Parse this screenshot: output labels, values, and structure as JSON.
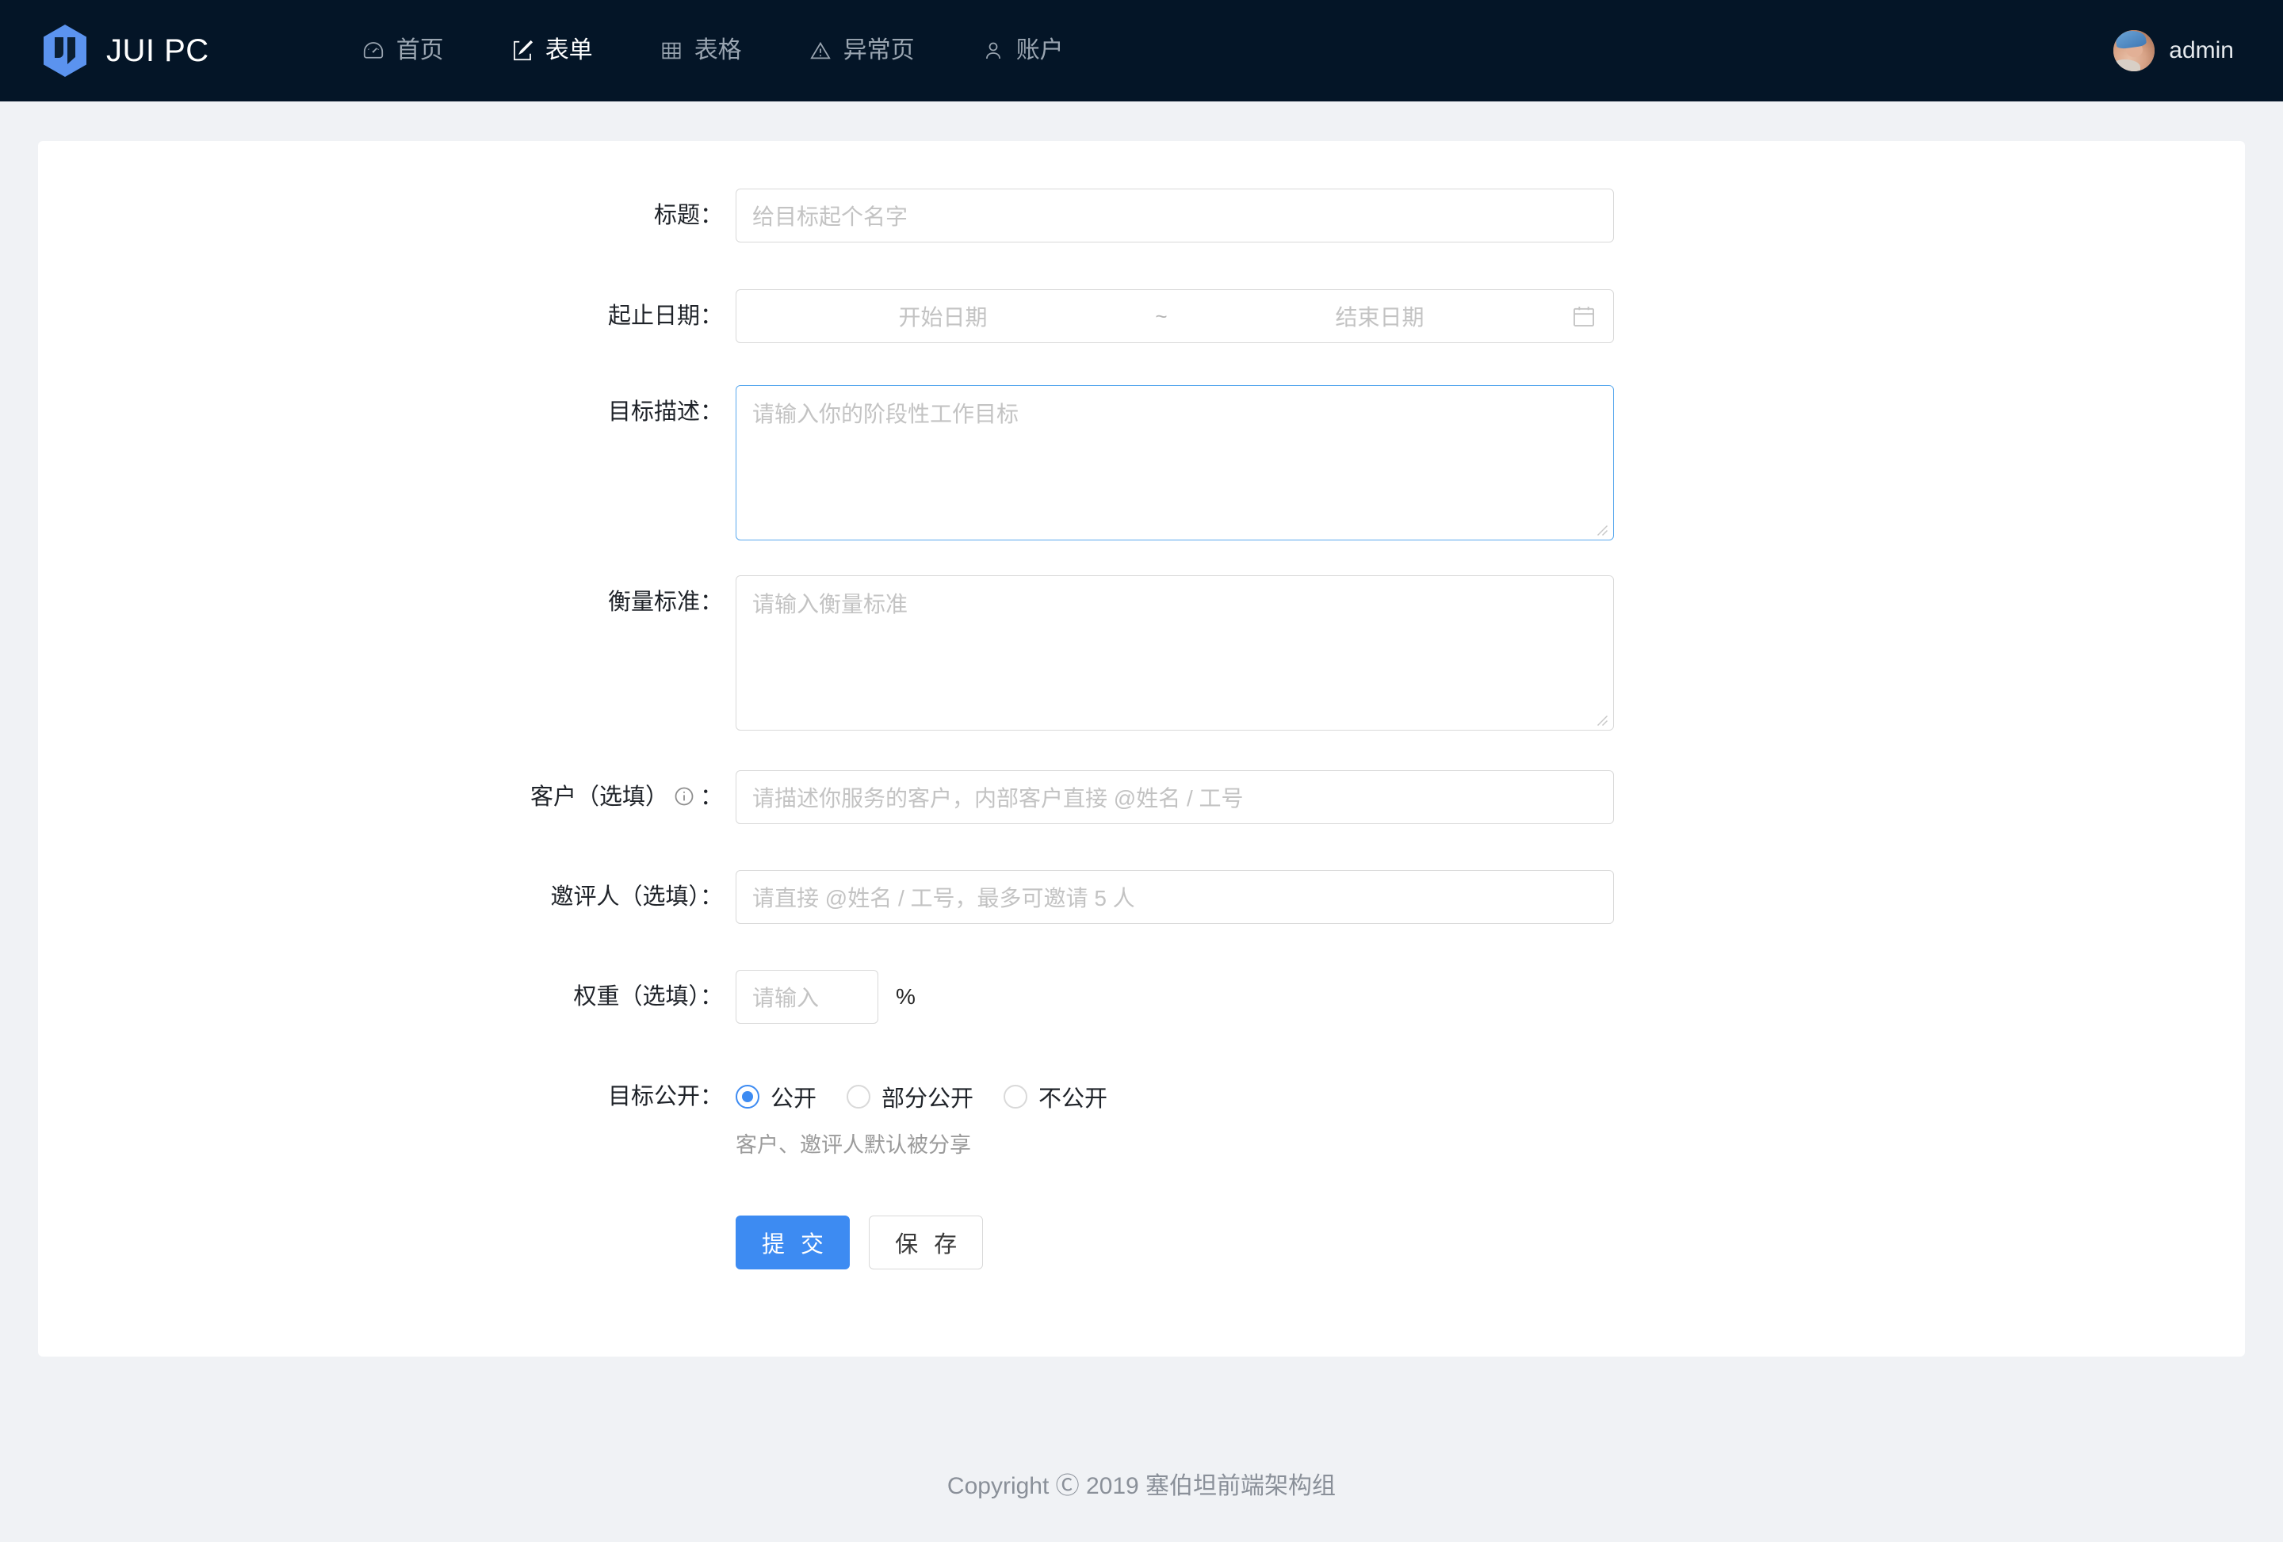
{
  "header": {
    "brand": "JUI PC",
    "logo_icon": "jui-hexagon-logo",
    "logo_color": "#5b93ef",
    "background": "#041527",
    "nav": [
      {
        "label": "首页",
        "icon": "dashboard-icon",
        "active": false
      },
      {
        "label": "表单",
        "icon": "edit-square-icon",
        "active": true
      },
      {
        "label": "表格",
        "icon": "table-grid-icon",
        "active": false
      },
      {
        "label": "异常页",
        "icon": "warning-triangle-icon",
        "active": false
      },
      {
        "label": "账户",
        "icon": "user-icon",
        "active": false
      }
    ],
    "user": {
      "name": "admin",
      "avatar_icon": "user-avatar-photo"
    }
  },
  "form": {
    "title_field": {
      "label": "标题：",
      "placeholder": "给目标起个名字",
      "value": ""
    },
    "date_range": {
      "label": "起止日期：",
      "start_placeholder": "开始日期",
      "separator": "~",
      "end_placeholder": "结束日期",
      "start_value": "",
      "end_value": "",
      "calendar_icon": "calendar-icon"
    },
    "goal_desc": {
      "label": "目标描述：",
      "placeholder": "请输入你的阶段性工作目标",
      "value": "",
      "focused": true
    },
    "metric": {
      "label": "衡量标准：",
      "placeholder": "请输入衡量标准",
      "value": "",
      "focused": false
    },
    "customer": {
      "label_main": "客户（选填）",
      "label_colon": "：",
      "info_icon": "info-circle-icon",
      "placeholder": "请描述你服务的客户，内部客户直接 @姓名 / 工号",
      "value": ""
    },
    "reviewer": {
      "label": "邀评人（选填）：",
      "placeholder": "请直接 @姓名 / 工号，最多可邀请 5 人",
      "value": ""
    },
    "weight": {
      "label": "权重（选填）：",
      "placeholder": "请输入",
      "value": "",
      "suffix": "%"
    },
    "visibility": {
      "label": "目标公开：",
      "options": [
        {
          "label": "公开",
          "selected": true
        },
        {
          "label": "部分公开",
          "selected": false
        },
        {
          "label": "不公开",
          "selected": false
        }
      ],
      "help": "客户、邀评人默认被分享"
    },
    "actions": {
      "submit": "提 交",
      "save": "保 存",
      "primary_color": "#3d8bf2"
    }
  },
  "footer": {
    "copyright": "Copyright Ⓒ 2019 塞伯坦前端架构组"
  }
}
